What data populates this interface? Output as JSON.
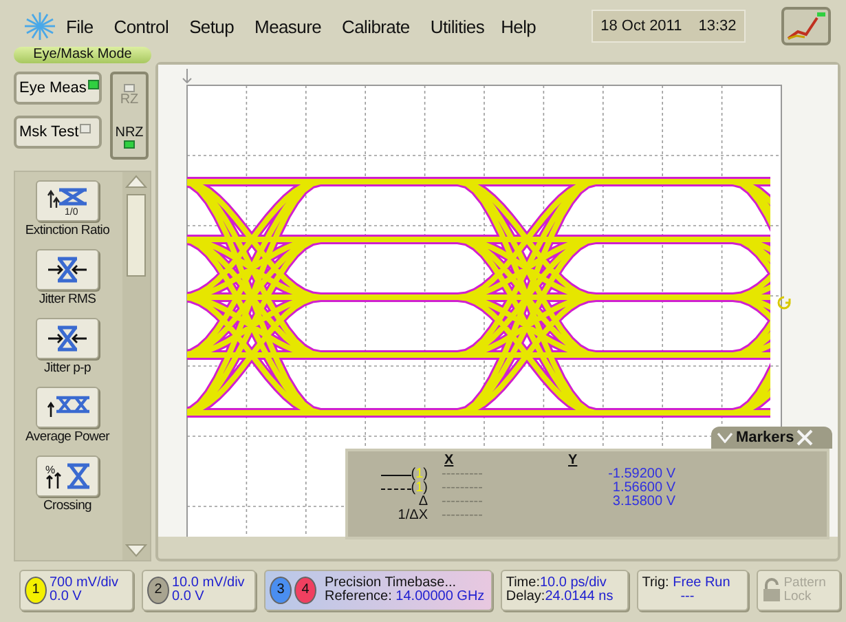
{
  "menu": [
    {
      "label": "File"
    },
    {
      "label": "Control"
    },
    {
      "label": "Setup"
    },
    {
      "label": "Measure"
    },
    {
      "label": "Calibrate"
    },
    {
      "label": "Utilities"
    },
    {
      "label": "Help"
    }
  ],
  "clock": {
    "date": "18 Oct 2011",
    "time": "13:32"
  },
  "mode": "Eye/Mask Mode",
  "mode_buttons": [
    {
      "label": "Eye Meas",
      "on": true
    },
    {
      "label": "Msk Test",
      "on": false
    }
  ],
  "format_buttons": [
    {
      "label": "RZ",
      "on": false
    },
    {
      "label": "NRZ",
      "on": true
    }
  ],
  "measurements": [
    {
      "kind": "extinction",
      "label": "Extinction Ratio",
      "icon_text": "1/0"
    },
    {
      "kind": "jitter-rms",
      "label": "Jitter RMS"
    },
    {
      "kind": "jitter-pp",
      "label": "Jitter p-p"
    },
    {
      "kind": "power",
      "label": "Average Power"
    },
    {
      "kind": "crossing",
      "label": "Crossing",
      "icon_text": "%"
    }
  ],
  "markers": {
    "title": "Markers",
    "col_x": "X",
    "col_y": "Y",
    "rows": [
      {
        "kind": "solid",
        "open": "(",
        "channel": "1",
        "close": ")",
        "x": "---------",
        "y": "-1.59200 V"
      },
      {
        "kind": "dashed",
        "open": "(",
        "channel": "1",
        "close": ")",
        "x": "---------",
        "y": "1.56600 V"
      },
      {
        "kind": "label",
        "label": "Δ",
        "x": "---------",
        "y": "3.15800 V"
      },
      {
        "kind": "label",
        "label": "1/ΔX",
        "x": "---------"
      }
    ]
  },
  "channels": [
    {
      "number": "1",
      "color": "#f4f000",
      "scale": "700 mV/div",
      "offset": "0.0 V"
    },
    {
      "number": "2",
      "color": "#a8a490",
      "scale": "10.0 mV/div",
      "offset": "0.0 V"
    }
  ],
  "timebase": {
    "badges": [
      {
        "number": "3",
        "color": "#4a8ef0"
      },
      {
        "number": "4",
        "color": "#f04060"
      }
    ],
    "title": "Precision Timebase...",
    "reference_label": "Reference:",
    "reference": "14.00000 GHz"
  },
  "time": {
    "scale_label": "Time:",
    "scale": "10.0 ps/div",
    "delay_label": "Delay:",
    "delay": "24.0144 ns"
  },
  "trigger": {
    "label": "Trig:",
    "mode": "Free Run",
    "level": "---"
  },
  "pattern_lock": {
    "label": "Pattern Lock",
    "disabled": true
  }
}
